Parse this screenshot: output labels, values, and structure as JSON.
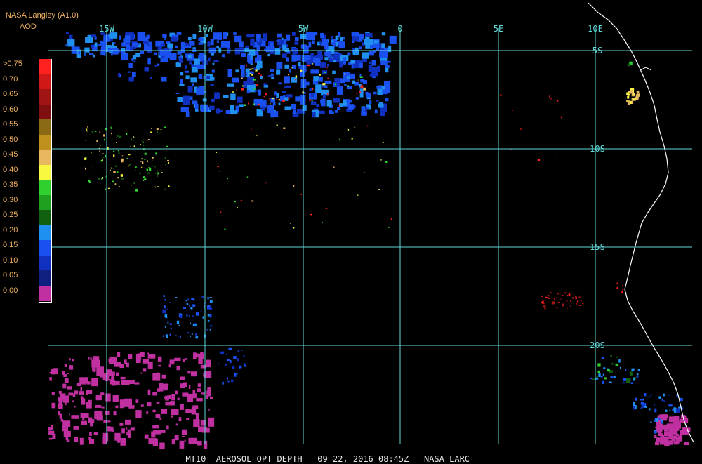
{
  "header": {
    "title": "NASA Langley (A1.0)",
    "subtitle": "AOD"
  },
  "legend": {
    "items": [
      {
        "label": ">0.75",
        "color": "#ff2020"
      },
      {
        "label": "0.70",
        "color": "#d01818"
      },
      {
        "label": "0.65",
        "color": "#a01414"
      },
      {
        "label": "0.60",
        "color": "#801010"
      },
      {
        "label": "0.55",
        "color": "#8a6a14"
      },
      {
        "label": "0.50",
        "color": "#c0901c"
      },
      {
        "label": "0.45",
        "color": "#e8b860"
      },
      {
        "label": "0.40",
        "color": "#f8f840"
      },
      {
        "label": "0.35",
        "color": "#30d030"
      },
      {
        "label": "0.30",
        "color": "#20a020"
      },
      {
        "label": "0.25",
        "color": "#106010"
      },
      {
        "label": "0.20",
        "color": "#2090f0"
      },
      {
        "label": "0.15",
        "color": "#1a50f0"
      },
      {
        "label": "0.10",
        "color": "#1030c0"
      },
      {
        "label": "0.05",
        "color": "#102080"
      },
      {
        "label": "0.00",
        "color": "#c030a0"
      }
    ]
  },
  "grid": {
    "lon_labels": [
      "15W",
      "10W",
      "5W",
      "0",
      "5E",
      "10E"
    ],
    "lat_labels": [
      "5S",
      "10S",
      "15S",
      "20S"
    ],
    "color": "#60d8d8"
  },
  "coastline_color": "#ffffff",
  "footer": {
    "text": "MT10  AEROSOL OPT DEPTH   09 22, 2016 08:45Z   NASA LARC"
  }
}
